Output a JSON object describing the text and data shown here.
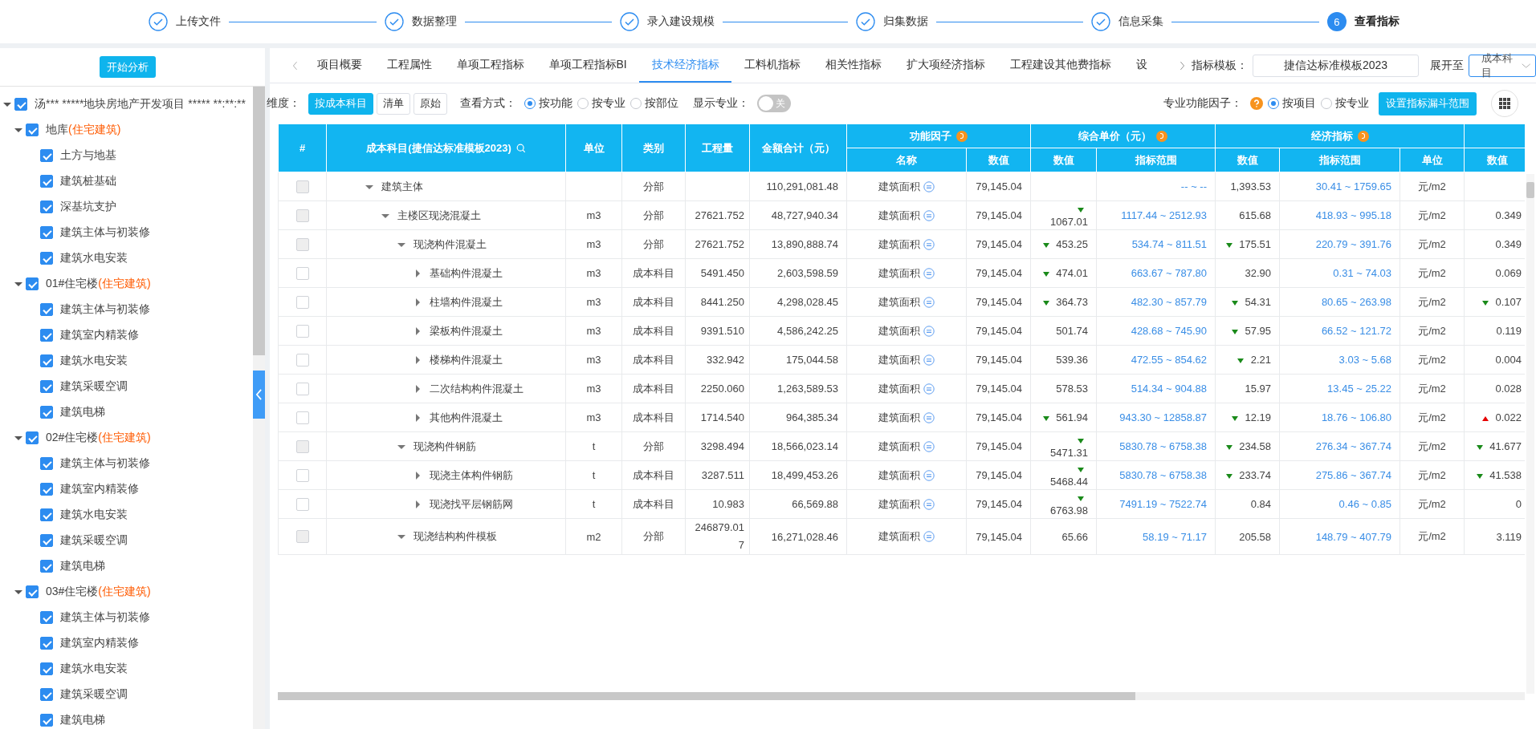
{
  "steps": [
    {
      "label": "上传文件",
      "done": true,
      "selected": false
    },
    {
      "label": "数据整理",
      "done": true,
      "selected": false
    },
    {
      "label": "录入建设规模",
      "done": true,
      "selected": false
    },
    {
      "label": "归集数据",
      "done": true,
      "selected": false
    },
    {
      "label": "信息采集",
      "done": true,
      "selected": false
    },
    {
      "label": "查看指标",
      "done": false,
      "selected": true,
      "number": "6"
    }
  ],
  "sidebar": {
    "button": "开始分析",
    "tree": [
      {
        "label": "汤*** *****地块房地产开发项目 ***** **:**:**",
        "checked": true,
        "expanded": true,
        "children": [
          {
            "label": "地库",
            "tag": "(住宅建筑)",
            "checked": true,
            "expanded": true,
            "children": [
              {
                "label": "土方与地基",
                "checked": true
              },
              {
                "label": "建筑桩基础",
                "checked": true
              },
              {
                "label": "深基坑支护",
                "checked": true
              },
              {
                "label": "建筑主体与初装修",
                "checked": true
              },
              {
                "label": "建筑水电安装",
                "checked": true
              }
            ]
          },
          {
            "label": "01#住宅楼",
            "tag": "(住宅建筑)",
            "checked": true,
            "expanded": true,
            "children": [
              {
                "label": "建筑主体与初装修",
                "checked": true
              },
              {
                "label": "建筑室内精装修",
                "checked": true
              },
              {
                "label": "建筑水电安装",
                "checked": true
              },
              {
                "label": "建筑采暖空调",
                "checked": true
              },
              {
                "label": "建筑电梯",
                "checked": true
              }
            ]
          },
          {
            "label": "02#住宅楼",
            "tag": "(住宅建筑)",
            "checked": true,
            "expanded": true,
            "children": [
              {
                "label": "建筑主体与初装修",
                "checked": true
              },
              {
                "label": "建筑室内精装修",
                "checked": true
              },
              {
                "label": "建筑水电安装",
                "checked": true
              },
              {
                "label": "建筑采暖空调",
                "checked": true
              },
              {
                "label": "建筑电梯",
                "checked": true
              }
            ]
          },
          {
            "label": "03#住宅楼",
            "tag": "(住宅建筑)",
            "checked": true,
            "expanded": true,
            "children": [
              {
                "label": "建筑主体与初装修",
                "checked": true
              },
              {
                "label": "建筑室内精装修",
                "checked": true
              },
              {
                "label": "建筑水电安装",
                "checked": true
              },
              {
                "label": "建筑采暖空调",
                "checked": true
              },
              {
                "label": "建筑电梯",
                "checked": true
              }
            ]
          }
        ]
      }
    ]
  },
  "tabs": [
    {
      "label": "项目概要",
      "selected": false
    },
    {
      "label": "工程属性",
      "selected": false
    },
    {
      "label": "单项工程指标",
      "selected": false
    },
    {
      "label": "单项工程指标BI",
      "selected": false
    },
    {
      "label": "技术经济指标",
      "selected": true
    },
    {
      "label": "工料机指标",
      "selected": false
    },
    {
      "label": "相关性指标",
      "selected": false
    },
    {
      "label": "扩大项经济指标",
      "selected": false
    },
    {
      "label": "工程建设其他费指标",
      "selected": false
    },
    {
      "label": "设",
      "selected": false
    }
  ],
  "template": {
    "label": "指标模板：",
    "value": "捷信达标准模板2023"
  },
  "expand_to": {
    "label": "展开至",
    "value": "成本科目"
  },
  "toolbar": {
    "dimension_label": "维度：",
    "dimension_buttons": [
      {
        "label": "按成本科目",
        "selected": true
      },
      {
        "label": "清单",
        "selected": false
      },
      {
        "label": "原始",
        "selected": false
      }
    ],
    "view_label": "查看方式：",
    "view_options": [
      {
        "label": "按功能",
        "selected": true
      },
      {
        "label": "按专业",
        "selected": false
      },
      {
        "label": "按部位",
        "selected": false
      }
    ],
    "show_major_label": "显示专业：",
    "show_major": {
      "on": false,
      "text": "关"
    },
    "factor_label": "专业功能因子：",
    "factor_options": [
      {
        "label": "按项目",
        "selected": true
      },
      {
        "label": "按专业",
        "selected": false
      }
    ],
    "funnel_button": "设置指标漏斗范围"
  },
  "table": {
    "columns": {
      "index": "#",
      "subject": "成本科目(捷信达标准模板2023)",
      "unit": "单位",
      "category": "类别",
      "quantity": "工程量",
      "amount": "金额合计（元）",
      "factor_group": "功能因子",
      "factor_name": "名称",
      "factor_value": "数值",
      "price_group": "综合单价（元）",
      "price_value": "数值",
      "price_range": "指标范围",
      "indicator_group": "经济指标",
      "indicator_value": "数值",
      "indicator_range": "指标范围",
      "indicator_unit": "单位",
      "column_14": "数值"
    },
    "rows": [
      {
        "name": "建筑主体",
        "expanded": true,
        "checkbox_disabled": true,
        "category": "分部",
        "amount": "110,291,081.48",
        "factor_name": "建筑面积",
        "factor_value": "79,145.04",
        "price": {
          "falling": false,
          "rising": false,
          "range": "-- ~ --"
        },
        "indicator": {
          "value": "1,393.53",
          "falling": false,
          "rising": false,
          "range": "30.41 ~ 1759.65",
          "unit": "元/m2"
        },
        "children": [
          {
            "name": "主楼区现浇混凝土",
            "expanded": true,
            "checkbox_disabled": true,
            "unit": "m3",
            "category": "分部",
            "quantity": "27621.752",
            "amount": "48,727,940.34",
            "factor_name": "建筑面积",
            "factor_value": "79,145.04",
            "price": {
              "value": "1067.01",
              "falling": true,
              "rising": false,
              "range": "1117.44 ~ 2512.93"
            },
            "indicator": {
              "value": "615.68",
              "falling": false,
              "rising": false,
              "range": "418.93 ~ 995.18",
              "unit": "元/m2"
            },
            "column_14": {
              "value": "0.349",
              "falling": false,
              "rising": false
            },
            "children": [
              {
                "name": "现浇构件混凝土",
                "expanded": true,
                "checkbox_disabled": true,
                "unit": "m3",
                "category": "分部",
                "quantity": "27621.752",
                "amount": "13,890,888.74",
                "factor_name": "建筑面积",
                "factor_value": "79,145.04",
                "price": {
                  "value": "453.25",
                  "falling": true,
                  "rising": false,
                  "range": "534.74 ~ 811.51"
                },
                "indicator": {
                  "value": "175.51",
                  "falling": true,
                  "rising": false,
                  "range": "220.79 ~ 391.76",
                  "unit": "元/m2"
                },
                "column_14": {
                  "value": "0.349",
                  "falling": false,
                  "rising": false
                },
                "children": [
                  {
                    "name": "基础构件混凝土",
                    "expanded": false,
                    "checkbox_disabled": false,
                    "unit": "m3",
                    "category": "成本科目",
                    "quantity": "5491.450",
                    "amount": "2,603,598.59",
                    "factor_name": "建筑面积",
                    "factor_value": "79,145.04",
                    "price": {
                      "value": "474.01",
                      "falling": true,
                      "rising": false,
                      "range": "663.67 ~ 787.80"
                    },
                    "indicator": {
                      "value": "32.90",
                      "falling": false,
                      "rising": false,
                      "range": "0.31 ~ 74.03",
                      "unit": "元/m2"
                    },
                    "column_14": {
                      "value": "0.069",
                      "falling": false,
                      "rising": false
                    }
                  },
                  {
                    "name": "柱墙构件混凝土",
                    "expanded": false,
                    "checkbox_disabled": false,
                    "unit": "m3",
                    "category": "成本科目",
                    "quantity": "8441.250",
                    "amount": "4,298,028.45",
                    "factor_name": "建筑面积",
                    "factor_value": "79,145.04",
                    "price": {
                      "value": "364.73",
                      "falling": true,
                      "rising": false,
                      "range": "482.30 ~ 857.79"
                    },
                    "indicator": {
                      "value": "54.31",
                      "falling": true,
                      "rising": false,
                      "range": "80.65 ~ 263.98",
                      "unit": "元/m2"
                    },
                    "column_14": {
                      "value": "0.107",
                      "falling": true,
                      "rising": false
                    }
                  },
                  {
                    "name": "梁板构件混凝土",
                    "expanded": false,
                    "checkbox_disabled": false,
                    "unit": "m3",
                    "category": "成本科目",
                    "quantity": "9391.510",
                    "amount": "4,586,242.25",
                    "factor_name": "建筑面积",
                    "factor_value": "79,145.04",
                    "price": {
                      "value": "501.74",
                      "falling": false,
                      "rising": false,
                      "range": "428.68 ~ 745.90"
                    },
                    "indicator": {
                      "value": "57.95",
                      "falling": true,
                      "rising": false,
                      "range": "66.52 ~ 121.72",
                      "unit": "元/m2"
                    },
                    "column_14": {
                      "value": "0.119",
                      "falling": false,
                      "rising": false
                    }
                  },
                  {
                    "name": "楼梯构件混凝土",
                    "expanded": false,
                    "checkbox_disabled": false,
                    "unit": "m3",
                    "category": "成本科目",
                    "quantity": "332.942",
                    "amount": "175,044.58",
                    "factor_name": "建筑面积",
                    "factor_value": "79,145.04",
                    "price": {
                      "value": "539.36",
                      "falling": false,
                      "rising": false,
                      "range": "472.55 ~ 854.62"
                    },
                    "indicator": {
                      "value": "2.21",
                      "falling": true,
                      "rising": false,
                      "range": "3.03 ~ 5.68",
                      "unit": "元/m2"
                    },
                    "column_14": {
                      "value": "0.004",
                      "falling": false,
                      "rising": false
                    }
                  },
                  {
                    "name": "二次结构构件混凝土",
                    "expanded": false,
                    "checkbox_disabled": false,
                    "unit": "m3",
                    "category": "成本科目",
                    "quantity": "2250.060",
                    "amount": "1,263,589.53",
                    "factor_name": "建筑面积",
                    "factor_value": "79,145.04",
                    "price": {
                      "value": "578.53",
                      "falling": false,
                      "rising": false,
                      "range": "514.34 ~ 904.88"
                    },
                    "indicator": {
                      "value": "15.97",
                      "falling": false,
                      "rising": false,
                      "range": "13.45 ~ 25.22",
                      "unit": "元/m2"
                    },
                    "column_14": {
                      "value": "0.028",
                      "falling": false,
                      "rising": false
                    }
                  },
                  {
                    "name": "其他构件混凝土",
                    "expanded": false,
                    "checkbox_disabled": false,
                    "unit": "m3",
                    "category": "成本科目",
                    "quantity": "1714.540",
                    "amount": "964,385.34",
                    "factor_name": "建筑面积",
                    "factor_value": "79,145.04",
                    "price": {
                      "value": "561.94",
                      "falling": true,
                      "rising": false,
                      "range": "943.30 ~ 12858.87"
                    },
                    "indicator": {
                      "value": "12.19",
                      "falling": true,
                      "rising": false,
                      "range": "18.76 ~ 106.80",
                      "unit": "元/m2"
                    },
                    "column_14": {
                      "value": "0.022",
                      "falling": false,
                      "rising": true
                    }
                  }
                ]
              },
              {
                "name": "现浇构件钢筋",
                "expanded": true,
                "checkbox_disabled": true,
                "unit": "t",
                "category": "分部",
                "quantity": "3298.494",
                "amount": "18,566,023.14",
                "factor_name": "建筑面积",
                "factor_value": "79,145.04",
                "price": {
                  "value": "5471.31",
                  "falling": true,
                  "rising": false,
                  "range": "5830.78 ~ 6758.38"
                },
                "indicator": {
                  "value": "234.58",
                  "falling": true,
                  "rising": false,
                  "range": "276.34 ~ 367.74",
                  "unit": "元/m2"
                },
                "column_14": {
                  "value": "41.677",
                  "falling": true,
                  "rising": false
                },
                "children": [
                  {
                    "name": "现浇主体构件钢筋",
                    "expanded": false,
                    "checkbox_disabled": false,
                    "unit": "t",
                    "category": "成本科目",
                    "quantity": "3287.511",
                    "amount": "18,499,453.26",
                    "factor_name": "建筑面积",
                    "factor_value": "79,145.04",
                    "price": {
                      "value": "5468.44",
                      "falling": true,
                      "rising": false,
                      "range": "5830.78 ~ 6758.38"
                    },
                    "indicator": {
                      "value": "233.74",
                      "falling": true,
                      "rising": false,
                      "range": "275.86 ~ 367.74",
                      "unit": "元/m2"
                    },
                    "column_14": {
                      "value": "41.538",
                      "falling": true,
                      "rising": false
                    }
                  },
                  {
                    "name": "现浇找平层钢筋网",
                    "expanded": false,
                    "checkbox_disabled": false,
                    "unit": "t",
                    "category": "成本科目",
                    "quantity": "10.983",
                    "amount": "66,569.88",
                    "factor_name": "建筑面积",
                    "factor_value": "79,145.04",
                    "price": {
                      "value": "6763.98",
                      "falling": true,
                      "rising": false,
                      "range": "7491.19 ~ 7522.74"
                    },
                    "indicator": {
                      "value": "0.84",
                      "falling": false,
                      "rising": false,
                      "range": "0.46 ~ 0.85",
                      "unit": "元/m2"
                    },
                    "column_14": {
                      "value": "0",
                      "falling": false,
                      "rising": false
                    }
                  }
                ]
              },
              {
                "name": "现浇结构构件模板",
                "expanded": true,
                "checkbox_disabled": true,
                "unit": "m2",
                "category": "分部",
                "quantity": "246879.017",
                "amount": "16,271,028.46",
                "factor_name": "建筑面积",
                "factor_value": "79,145.04",
                "price": {
                  "value": "65.66",
                  "falling": false,
                  "rising": false,
                  "range": "58.19 ~ 71.17"
                },
                "indicator": {
                  "value": "205.58",
                  "falling": false,
                  "rising": false,
                  "range": "148.79 ~ 407.79",
                  "unit": "元/m2"
                },
                "column_14": {
                  "value": "3.119",
                  "falling": false,
                  "rising": false
                }
              }
            ]
          }
        ]
      }
    ]
  }
}
